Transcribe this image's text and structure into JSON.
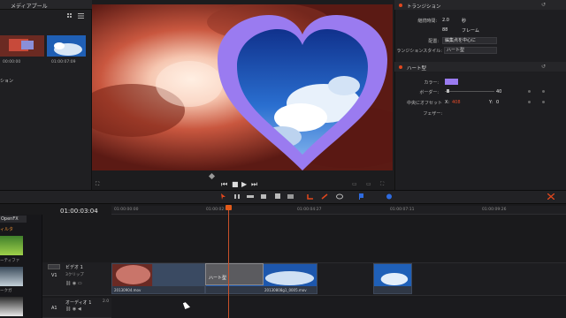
{
  "media_pool": {
    "title": "メディアプール",
    "side_label": "ション",
    "thumbnails": [
      {
        "label": "00:00:00"
      },
      {
        "label": "01:00:07:09"
      }
    ]
  },
  "inspector": {
    "transition_section": {
      "title": "トランジション",
      "duration_label": "継続時間:",
      "duration_value": "2.0",
      "duration_unit": "秒",
      "frames_value": "88",
      "frames_unit": "フレーム",
      "alignment_label": "配置:",
      "alignment_value": "編集点を中心に",
      "style_label": "ランジションスタイル:",
      "style_value": "ハート型"
    },
    "heart_section": {
      "title": "ハート型",
      "color_label": "カラー:",
      "color_value": "#9a7bf0",
      "border_label": "ボーダー:",
      "border_value": "40",
      "offset_label": "中央にオフセット",
      "offset_x_label": "X:",
      "offset_x_value": "408",
      "offset_y_label": "Y:",
      "offset_y_value": "0",
      "feather_label": "フェザー:"
    }
  },
  "timeline": {
    "timecode": "01:00:03:04",
    "ruler_ticks": [
      "01:00:00:00",
      "01:00:02:",
      "01:00:04:27",
      "01:00:07:11",
      "01:00:09:26"
    ],
    "openfx_tab": "OpenFX",
    "fx_list_label": "ィルタ",
    "fx_side_labels": [
      "ーティファ",
      "ークガ"
    ],
    "tracks": {
      "video": {
        "id": "V1",
        "name": "ビデオ 1",
        "sub": "3クリップ"
      },
      "audio": {
        "id": "A1",
        "name": "オーディオ 1",
        "sub": "2.0"
      }
    },
    "clips": [
      {
        "name": "20130904.mov"
      },
      {
        "name": "20130808g1_0005.mov"
      },
      {
        "name": ""
      }
    ],
    "transition_label": "ハート型"
  },
  "colors": {
    "accent": "#e25a1a",
    "heart": "#9a7bf0",
    "clip_blue": "#303846"
  },
  "icons": [
    "grid-icon",
    "list-icon",
    "reset-icon",
    "play-icon",
    "stop-icon",
    "rewind-icon",
    "forward-icon",
    "blade-icon",
    "link-icon",
    "flag-icon",
    "marker-icon"
  ]
}
